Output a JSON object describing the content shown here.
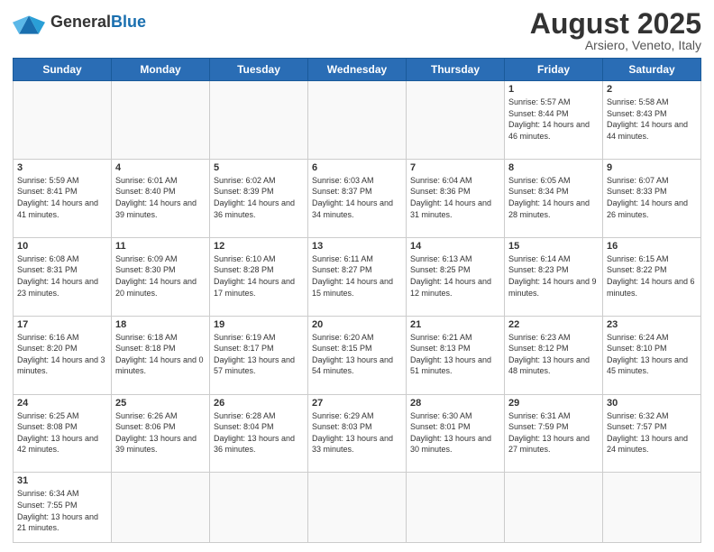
{
  "logo": {
    "text_general": "General",
    "text_blue": "Blue"
  },
  "title": {
    "main": "August 2025",
    "sub": "Arsiero, Veneto, Italy"
  },
  "headers": [
    "Sunday",
    "Monday",
    "Tuesday",
    "Wednesday",
    "Thursday",
    "Friday",
    "Saturday"
  ],
  "weeks": [
    [
      {
        "date": "",
        "info": ""
      },
      {
        "date": "",
        "info": ""
      },
      {
        "date": "",
        "info": ""
      },
      {
        "date": "",
        "info": ""
      },
      {
        "date": "",
        "info": ""
      },
      {
        "date": "1",
        "info": "Sunrise: 5:57 AM\nSunset: 8:44 PM\nDaylight: 14 hours and 46 minutes."
      },
      {
        "date": "2",
        "info": "Sunrise: 5:58 AM\nSunset: 8:43 PM\nDaylight: 14 hours and 44 minutes."
      }
    ],
    [
      {
        "date": "3",
        "info": "Sunrise: 5:59 AM\nSunset: 8:41 PM\nDaylight: 14 hours and 41 minutes."
      },
      {
        "date": "4",
        "info": "Sunrise: 6:01 AM\nSunset: 8:40 PM\nDaylight: 14 hours and 39 minutes."
      },
      {
        "date": "5",
        "info": "Sunrise: 6:02 AM\nSunset: 8:39 PM\nDaylight: 14 hours and 36 minutes."
      },
      {
        "date": "6",
        "info": "Sunrise: 6:03 AM\nSunset: 8:37 PM\nDaylight: 14 hours and 34 minutes."
      },
      {
        "date": "7",
        "info": "Sunrise: 6:04 AM\nSunset: 8:36 PM\nDaylight: 14 hours and 31 minutes."
      },
      {
        "date": "8",
        "info": "Sunrise: 6:05 AM\nSunset: 8:34 PM\nDaylight: 14 hours and 28 minutes."
      },
      {
        "date": "9",
        "info": "Sunrise: 6:07 AM\nSunset: 8:33 PM\nDaylight: 14 hours and 26 minutes."
      }
    ],
    [
      {
        "date": "10",
        "info": "Sunrise: 6:08 AM\nSunset: 8:31 PM\nDaylight: 14 hours and 23 minutes."
      },
      {
        "date": "11",
        "info": "Sunrise: 6:09 AM\nSunset: 8:30 PM\nDaylight: 14 hours and 20 minutes."
      },
      {
        "date": "12",
        "info": "Sunrise: 6:10 AM\nSunset: 8:28 PM\nDaylight: 14 hours and 17 minutes."
      },
      {
        "date": "13",
        "info": "Sunrise: 6:11 AM\nSunset: 8:27 PM\nDaylight: 14 hours and 15 minutes."
      },
      {
        "date": "14",
        "info": "Sunrise: 6:13 AM\nSunset: 8:25 PM\nDaylight: 14 hours and 12 minutes."
      },
      {
        "date": "15",
        "info": "Sunrise: 6:14 AM\nSunset: 8:23 PM\nDaylight: 14 hours and 9 minutes."
      },
      {
        "date": "16",
        "info": "Sunrise: 6:15 AM\nSunset: 8:22 PM\nDaylight: 14 hours and 6 minutes."
      }
    ],
    [
      {
        "date": "17",
        "info": "Sunrise: 6:16 AM\nSunset: 8:20 PM\nDaylight: 14 hours and 3 minutes."
      },
      {
        "date": "18",
        "info": "Sunrise: 6:18 AM\nSunset: 8:18 PM\nDaylight: 14 hours and 0 minutes."
      },
      {
        "date": "19",
        "info": "Sunrise: 6:19 AM\nSunset: 8:17 PM\nDaylight: 13 hours and 57 minutes."
      },
      {
        "date": "20",
        "info": "Sunrise: 6:20 AM\nSunset: 8:15 PM\nDaylight: 13 hours and 54 minutes."
      },
      {
        "date": "21",
        "info": "Sunrise: 6:21 AM\nSunset: 8:13 PM\nDaylight: 13 hours and 51 minutes."
      },
      {
        "date": "22",
        "info": "Sunrise: 6:23 AM\nSunset: 8:12 PM\nDaylight: 13 hours and 48 minutes."
      },
      {
        "date": "23",
        "info": "Sunrise: 6:24 AM\nSunset: 8:10 PM\nDaylight: 13 hours and 45 minutes."
      }
    ],
    [
      {
        "date": "24",
        "info": "Sunrise: 6:25 AM\nSunset: 8:08 PM\nDaylight: 13 hours and 42 minutes."
      },
      {
        "date": "25",
        "info": "Sunrise: 6:26 AM\nSunset: 8:06 PM\nDaylight: 13 hours and 39 minutes."
      },
      {
        "date": "26",
        "info": "Sunrise: 6:28 AM\nSunset: 8:04 PM\nDaylight: 13 hours and 36 minutes."
      },
      {
        "date": "27",
        "info": "Sunrise: 6:29 AM\nSunset: 8:03 PM\nDaylight: 13 hours and 33 minutes."
      },
      {
        "date": "28",
        "info": "Sunrise: 6:30 AM\nSunset: 8:01 PM\nDaylight: 13 hours and 30 minutes."
      },
      {
        "date": "29",
        "info": "Sunrise: 6:31 AM\nSunset: 7:59 PM\nDaylight: 13 hours and 27 minutes."
      },
      {
        "date": "30",
        "info": "Sunrise: 6:32 AM\nSunset: 7:57 PM\nDaylight: 13 hours and 24 minutes."
      }
    ],
    [
      {
        "date": "31",
        "info": "Sunrise: 6:34 AM\nSunset: 7:55 PM\nDaylight: 13 hours and 21 minutes."
      },
      {
        "date": "",
        "info": ""
      },
      {
        "date": "",
        "info": ""
      },
      {
        "date": "",
        "info": ""
      },
      {
        "date": "",
        "info": ""
      },
      {
        "date": "",
        "info": ""
      },
      {
        "date": "",
        "info": ""
      }
    ]
  ]
}
